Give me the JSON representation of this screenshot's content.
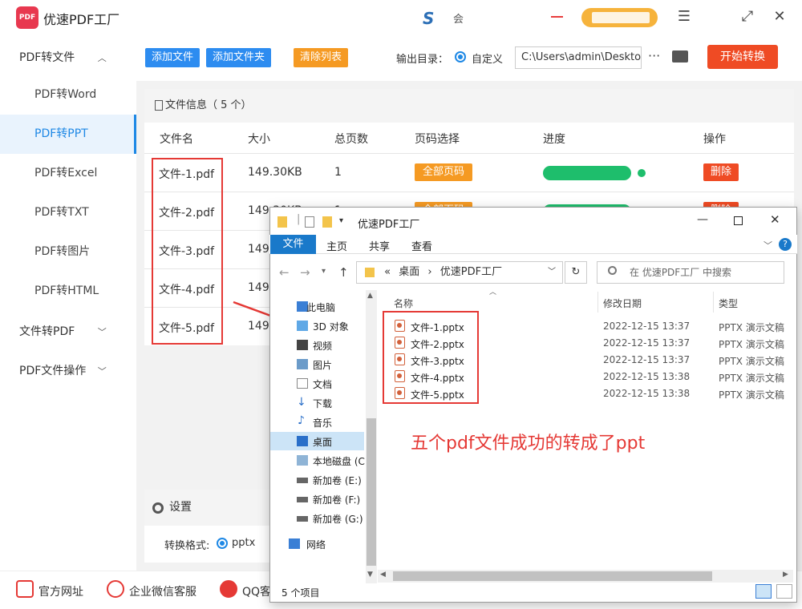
{
  "app": {
    "title": "优速PDF工厂",
    "logo_text": "PDF",
    "vip_text": "会"
  },
  "window_controls": {
    "menu": "☰",
    "maximize": "⤢",
    "close": "✕"
  },
  "sidebar": {
    "group1": "PDF转文件",
    "items": [
      "PDF转Word",
      "PDF转PPT",
      "PDF转Excel",
      "PDF转TXT",
      "PDF转图片",
      "PDF转HTML"
    ],
    "active": "PDF转PPT",
    "group2": "文件转PDF",
    "group3": "PDF文件操作"
  },
  "toolbar": {
    "add_file": "添加文件",
    "add_folder": "添加文件夹",
    "clear_list": "清除列表",
    "output_label": "输出目录：",
    "custom_label": "自定义",
    "output_path": "C:\\Users\\admin\\Deskto",
    "more": "···",
    "start": "开始转换"
  },
  "file_table": {
    "header": "文件信息（ 5 个）",
    "columns": [
      "文件名",
      "大小",
      "总页数",
      "页码选择",
      "进度",
      "操作"
    ],
    "rows": [
      {
        "name": "文件-1.pdf",
        "size": "149.30KB",
        "pages": "1"
      },
      {
        "name": "文件-2.pdf",
        "size": "149.30KB",
        "pages": "1"
      },
      {
        "name": "文件-3.pdf",
        "size": "149."
      },
      {
        "name": "文件-4.pdf",
        "size": "149."
      },
      {
        "name": "文件-5.pdf",
        "size": "149."
      }
    ],
    "page_select": "全部页码",
    "delete": "删除",
    "progress": 1.0
  },
  "settings": {
    "header": "设置",
    "format_label": "转换格式:",
    "format_value": "pptx"
  },
  "bottom": {
    "website": "官方网址",
    "wechat": "企业微信客服",
    "qq": "QQ客"
  },
  "explorer": {
    "title": "优速PDF工厂",
    "tabs": {
      "file": "文件",
      "home": "主页",
      "share": "共享",
      "view": "查看"
    },
    "address": {
      "prefix": "«",
      "desktop": "桌面",
      "sep": "›",
      "folder": "优速PDF工厂"
    },
    "search_placeholder": "在 优速PDF工厂 中搜索",
    "nav": [
      "此电脑",
      "3D 对象",
      "视频",
      "图片",
      "文档",
      "下载",
      "音乐",
      "桌面",
      "本地磁盘 (C",
      "新加卷 (E:)",
      "新加卷 (F:)",
      "新加卷 (G:)",
      "网络"
    ],
    "columns": {
      "name": "名称",
      "date": "修改日期",
      "type": "类型"
    },
    "files": [
      {
        "name": "文件-1.pptx",
        "date": "2022-12-15 13:37",
        "type": "PPTX 演示文稿"
      },
      {
        "name": "文件-2.pptx",
        "date": "2022-12-15 13:37",
        "type": "PPTX 演示文稿"
      },
      {
        "name": "文件-3.pptx",
        "date": "2022-12-15 13:37",
        "type": "PPTX 演示文稿"
      },
      {
        "name": "文件-4.pptx",
        "date": "2022-12-15 13:38",
        "type": "PPTX 演示文稿"
      },
      {
        "name": "文件-5.pptx",
        "date": "2022-12-15 13:38",
        "type": "PPTX 演示文稿"
      }
    ],
    "status": "5 个项目"
  },
  "annotation": "五个pdf文件成功的转成了ppt",
  "colors": {
    "accent": "#1e88e5",
    "orange": "#f59a23",
    "red": "#ef4b24",
    "green": "#1ebe6c"
  }
}
